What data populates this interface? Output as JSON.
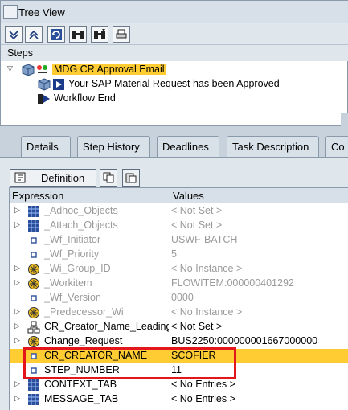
{
  "tree_view": {
    "title": "Tree View",
    "toolbar_icons": [
      "expand-all-icon",
      "collapse-all-icon",
      "refresh-icon",
      "find-icon",
      "find-next-icon",
      "print-icon"
    ],
    "steps_label": "Steps",
    "nodes": [
      {
        "text": "MDG CR Approval Email",
        "selected": true
      },
      {
        "text": "Your SAP Material Request has been Approved"
      },
      {
        "text": "Workflow End"
      }
    ]
  },
  "tabs": [
    "Details",
    "Step History",
    "Deadlines",
    "Task Description",
    "Co"
  ],
  "detail": {
    "definition_button": "Definition",
    "columns": {
      "expression": "Expression",
      "values": "Values"
    },
    "rows": [
      {
        "name": "_Adhoc_Objects",
        "value": "< Not Set >",
        "icon": "table-icon",
        "expander": true,
        "grey": true
      },
      {
        "name": "_Attach_Objects",
        "value": "< Not Set >",
        "icon": "table-icon",
        "expander": true,
        "grey": true
      },
      {
        "name": "_Wf_Initiator",
        "value": "USWF-BATCH",
        "icon": "field-icon",
        "expander": false,
        "grey": true
      },
      {
        "name": "_Wf_Priority",
        "value": "5",
        "icon": "field-icon",
        "expander": false,
        "grey": true
      },
      {
        "name": "_Wi_Group_ID",
        "value": "< No Instance >",
        "icon": "object-icon",
        "expander": true,
        "grey": true
      },
      {
        "name": "_Workitem",
        "value": "FLOWITEM:000000401292",
        "icon": "object-icon",
        "expander": true,
        "grey": true
      },
      {
        "name": "_Wf_Version",
        "value": "0000",
        "icon": "field-icon",
        "expander": false,
        "grey": true
      },
      {
        "name": "_Predecessor_Wi",
        "value": "< No Instance >",
        "icon": "object-icon",
        "expander": true,
        "grey": true
      },
      {
        "name": "CR_Creator_Name_Leading",
        "value": "< Not Set >",
        "icon": "structure-icon",
        "expander": true,
        "grey": false
      },
      {
        "name": "Change_Request",
        "value": "BUS2250:000000001667000000",
        "icon": "object-icon",
        "expander": true,
        "grey": false
      },
      {
        "name": "CR_CREATOR_NAME",
        "value": "SCOFIER",
        "icon": "field-icon",
        "expander": false,
        "grey": false,
        "highlight": true
      },
      {
        "name": "STEP_NUMBER",
        "value": "11",
        "icon": "field-icon",
        "expander": false,
        "grey": false
      },
      {
        "name": "CONTEXT_TAB",
        "value": "< No Entries >",
        "icon": "table-icon",
        "expander": true,
        "grey": false
      },
      {
        "name": "MESSAGE_TAB",
        "value": "< No Entries >",
        "icon": "table-icon",
        "expander": true,
        "grey": false
      }
    ]
  },
  "colors": {
    "highlight": "#ffcc33",
    "annotation": "#e3161c",
    "icon_blue": "#2b4f9a"
  }
}
